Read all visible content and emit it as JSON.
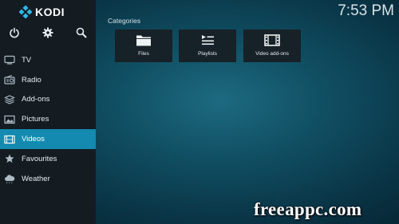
{
  "app": {
    "name": "KODI"
  },
  "clock": {
    "time": "7:53 PM"
  },
  "sidebar": {
    "top_icons": [
      "power-icon",
      "gear-icon",
      "search-icon"
    ],
    "items": [
      {
        "label": "TV",
        "icon": "tv-icon"
      },
      {
        "label": "Radio",
        "icon": "radio-icon"
      },
      {
        "label": "Add-ons",
        "icon": "addons-icon"
      },
      {
        "label": "Pictures",
        "icon": "picture-icon"
      },
      {
        "label": "Videos",
        "icon": "film-icon",
        "active": true
      },
      {
        "label": "Favourites",
        "icon": "star-icon"
      },
      {
        "label": "Weather",
        "icon": "cloud-icon"
      }
    ]
  },
  "main": {
    "section_title": "Categories",
    "tiles": [
      {
        "label": "Files",
        "icon": "folder-icon"
      },
      {
        "label": "Playlists",
        "icon": "playlist-icon"
      },
      {
        "label": "Video add-ons",
        "icon": "film-icon"
      }
    ]
  },
  "watermark": {
    "text": "freeappc.com"
  },
  "colors": {
    "accent": "#148ab0",
    "sidebar_bg": "#141c22",
    "tile_bg": "#172128",
    "background": "#104e62"
  }
}
